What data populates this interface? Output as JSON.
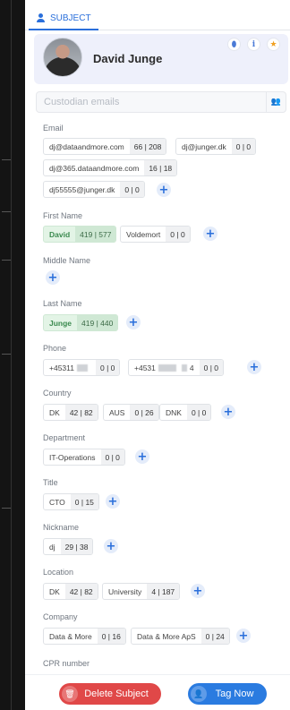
{
  "tab": {
    "label": "SUBJECT",
    "icon": "user-icon"
  },
  "subject": {
    "name": "David Junge"
  },
  "header_buttons": [
    {
      "icon": "shield-icon",
      "glyph": "⬮",
      "color": "#4a7ad6"
    },
    {
      "icon": "info-icon",
      "glyph": "i",
      "color": "#4a7ad6"
    },
    {
      "icon": "star-icon",
      "glyph": "★",
      "color": "#f0a020"
    }
  ],
  "custodian": {
    "placeholder": "Custodian emails",
    "icon": "group-icon"
  },
  "sections": {
    "email": {
      "label": "Email",
      "items": [
        {
          "value": "dj@dataandmore.com",
          "count": "66 | 208"
        },
        {
          "value": "dj@junger.dk",
          "count": "0 | 0"
        },
        {
          "value": "dj@365.dataandmore.com",
          "count": "16 | 18"
        },
        {
          "value": "dj55555@junger.dk",
          "count": "0 | 0"
        }
      ]
    },
    "first_name": {
      "label": "First Name",
      "items": [
        {
          "value": "David",
          "count": "419 | 577"
        },
        {
          "value": "Voldemort",
          "count": "0 | 0"
        }
      ]
    },
    "middle_name": {
      "label": "Middle Name",
      "items": []
    },
    "last_name": {
      "label": "Last Name",
      "items": [
        {
          "value": "Junge",
          "count": "419 | 440"
        }
      ]
    },
    "phone": {
      "label": "Phone",
      "items": [
        {
          "value_a": "+45311",
          "value_b": "",
          "count": "0 | 0"
        },
        {
          "value_a": "+4531",
          "value_b": "4",
          "count": "0 | 0"
        }
      ]
    },
    "country": {
      "label": "Country",
      "items": [
        {
          "value": "DK",
          "count": "42 | 82"
        },
        {
          "value": "AUS",
          "count": "0 | 26"
        },
        {
          "value": "DNK",
          "count": "0 | 0"
        }
      ]
    },
    "department": {
      "label": "Department",
      "items": [
        {
          "value": "IT-Operations",
          "count": "0 | 0"
        }
      ]
    },
    "title": {
      "label": "Title",
      "items": [
        {
          "value": "CTO",
          "count": "0 | 15"
        }
      ]
    },
    "nickname": {
      "label": "Nickname",
      "items": [
        {
          "value": "dj",
          "count": "29 | 38"
        }
      ]
    },
    "location": {
      "label": "Location",
      "items": [
        {
          "value": "DK",
          "count": "42 | 82"
        },
        {
          "value": "University",
          "count": "4 | 187"
        }
      ]
    },
    "company": {
      "label": "Company",
      "items": [
        {
          "value": "Data & More",
          "count": "0 | 16"
        },
        {
          "value": "Data & More ApS",
          "count": "0 | 24"
        }
      ]
    },
    "cpr": {
      "label": "CPR number"
    }
  },
  "footer": {
    "delete": {
      "label": "Delete Subject",
      "icon": "trash-icon",
      "color": "#e04848"
    },
    "tag": {
      "label": "Tag Now",
      "icon": "user-tag-icon",
      "color": "#2a7be0"
    }
  }
}
